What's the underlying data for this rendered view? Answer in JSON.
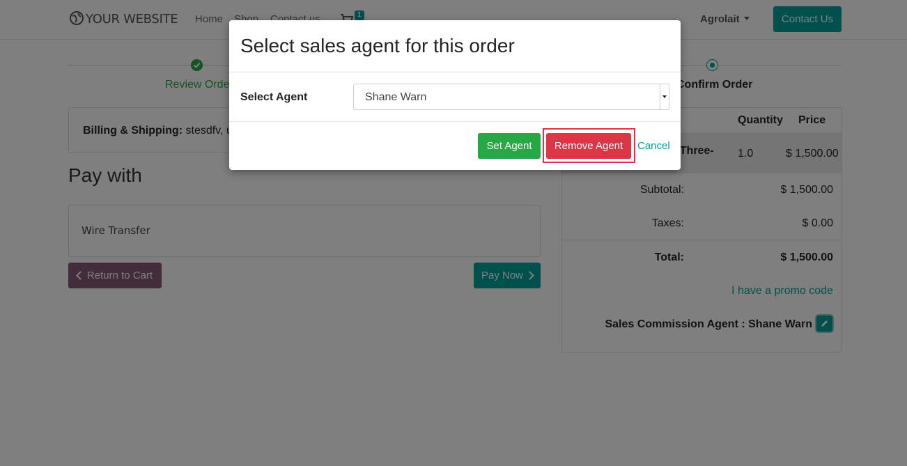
{
  "navbar": {
    "brand": "YOUR WEBSITE",
    "links": [
      "Home",
      "Shop",
      "Contact us"
    ],
    "cart_count": "1",
    "user": "Agrolait",
    "contact_button": "Contact Us"
  },
  "wizard": {
    "step1": "Review Order",
    "step3": "Confirm Order"
  },
  "billing": {
    "label": "Billing & Shipping:",
    "value": "stesdfv, ujg"
  },
  "payment": {
    "title": "Pay with",
    "method": "Wire Transfer",
    "return_button": "Return to Cart",
    "pay_button": "Pay Now"
  },
  "summary": {
    "headers": {
      "quantity": "Quantity",
      "price": "Price"
    },
    "product": {
      "name": "] Three-",
      "quantity": "1.0",
      "price": "$ 1,500.00"
    },
    "subtotal_label": "Subtotal:",
    "subtotal_value": "$ 1,500.00",
    "taxes_label": "Taxes:",
    "taxes_value": "$ 0.00",
    "total_label": "Total:",
    "total_value": "$ 1,500.00",
    "promo": "I have a promo code",
    "agent_line": "Sales Commission Agent : Shane Warn"
  },
  "modal": {
    "title": "Select sales agent for this order",
    "field_label": "Select Agent",
    "selected_agent": "Shane Warn",
    "set_button": "Set Agent",
    "remove_button": "Remove Agent",
    "cancel_link": "Cancel"
  },
  "colors": {
    "primary": "#00A09D",
    "success": "#28a745",
    "danger": "#dc3545",
    "secondary": "#875A7B"
  }
}
